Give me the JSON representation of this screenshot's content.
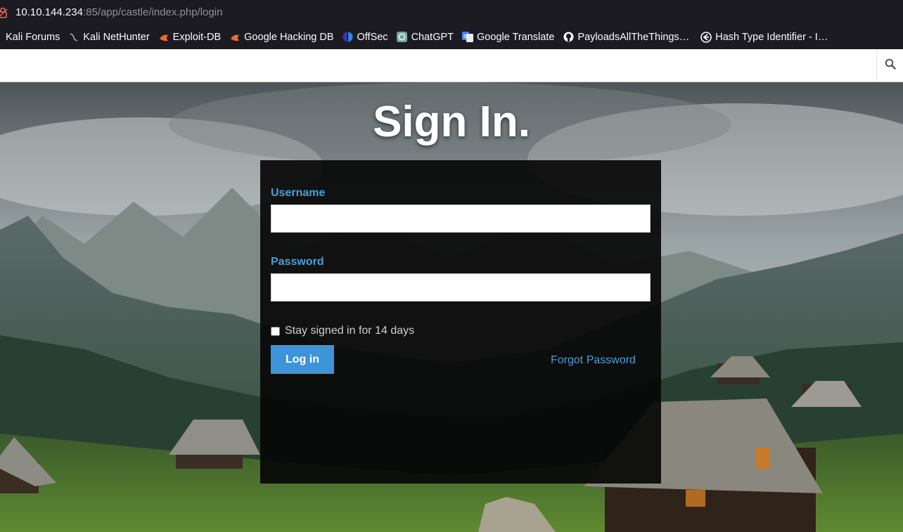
{
  "browser": {
    "url_host": "10.10.144.234",
    "url_rest": ":85/app/castle/index.php/login",
    "bookmarks": [
      {
        "label": "Kali Forums",
        "icon": "kali-icon"
      },
      {
        "label": "Kali NetHunter",
        "icon": "nethunter-icon"
      },
      {
        "label": "Exploit-DB",
        "icon": "exploit-db-icon"
      },
      {
        "label": "Google Hacking DB",
        "icon": "ghdb-icon"
      },
      {
        "label": "OffSec",
        "icon": "offsec-icon"
      },
      {
        "label": "ChatGPT",
        "icon": "chatgpt-icon"
      },
      {
        "label": "Google Translate",
        "icon": "google-translate-icon"
      },
      {
        "label": "PayloadsAllTheThings…",
        "icon": "github-icon"
      },
      {
        "label": "Hash Type Identifier - I…",
        "icon": "hash-identifier-icon"
      }
    ]
  },
  "header": {
    "search_icon": "search-icon"
  },
  "login": {
    "title": "Sign In.",
    "username_label": "Username",
    "username_value": "",
    "password_label": "Password",
    "password_value": "",
    "remember_label": "Stay signed in for 14 days",
    "remember_checked": false,
    "login_button": "Log in",
    "forgot_link": "Forgot Password"
  },
  "colors": {
    "accent": "#3d94d8",
    "label_blue": "#4a9fd8",
    "panel_bg": "#080808",
    "chrome_bg": "#1c1b22"
  }
}
